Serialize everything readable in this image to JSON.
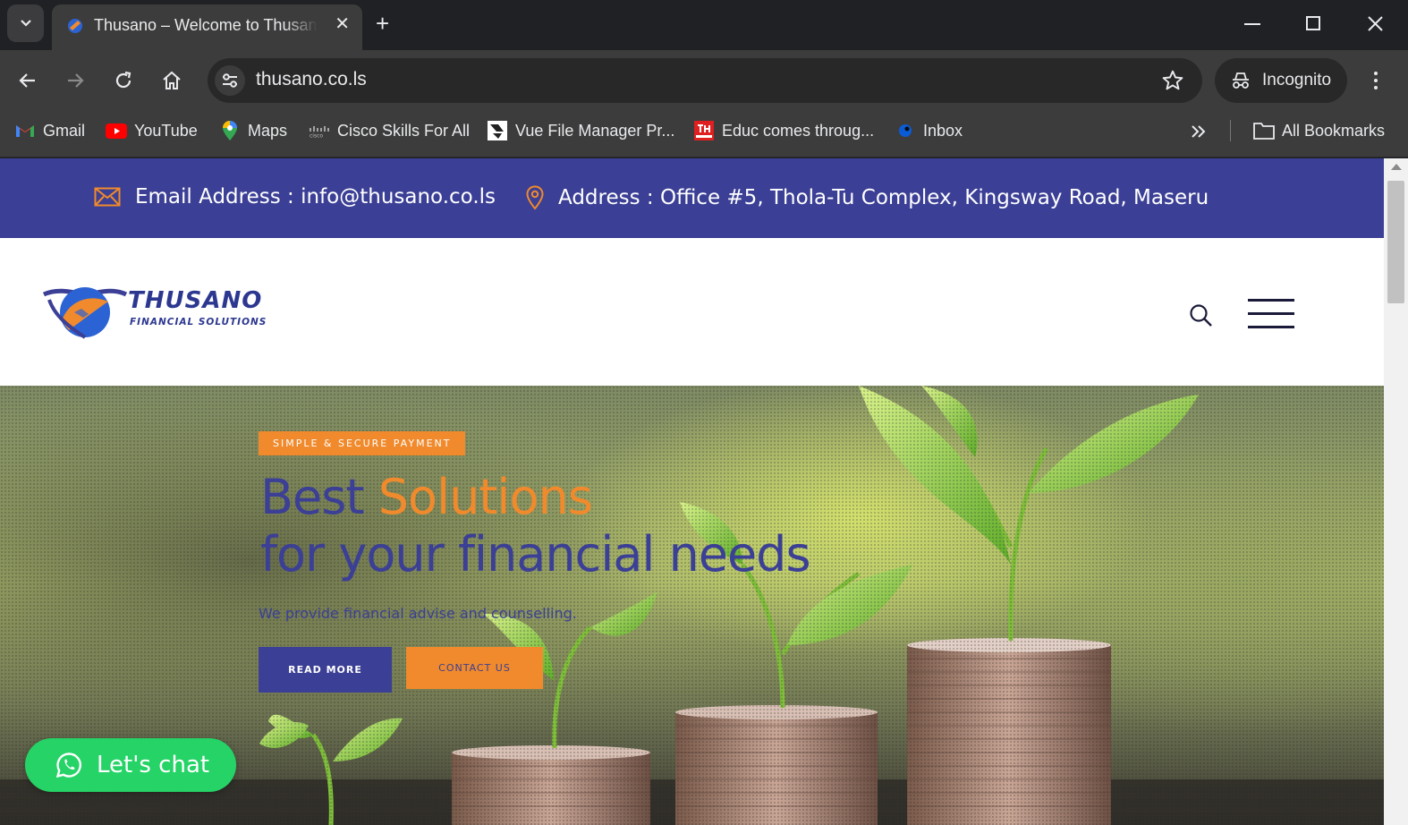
{
  "browser": {
    "tab_title": "Thusano – Welcome to Thusano",
    "url": "thusano.co.ls",
    "incognito_label": "Incognito",
    "bookmarks": [
      {
        "label": "Gmail",
        "icon": "gmail-icon"
      },
      {
        "label": "YouTube",
        "icon": "youtube-icon"
      },
      {
        "label": "Maps",
        "icon": "maps-icon"
      },
      {
        "label": "Cisco Skills For All",
        "icon": "cisco-icon"
      },
      {
        "label": "Vue File Manager Pr...",
        "icon": "vue-file-manager-icon"
      },
      {
        "label": "Educ comes throug...",
        "icon": "the-reporter-icon"
      },
      {
        "label": "Inbox",
        "icon": "inbox-icon"
      }
    ],
    "all_bookmarks_label": "All Bookmarks"
  },
  "topbar": {
    "email_label": "Email Address : info@thusano.co.ls",
    "address_label": "Address : Office #5, Thola-Tu Complex, Kingsway Road, Maseru"
  },
  "logo": {
    "name": "THUSANO",
    "tagline": "FINANCIAL SOLUTIONS"
  },
  "hero": {
    "badge": "SIMPLE & SECURE PAYMENT",
    "headline_start": "Best",
    "headline_accent": "Solutions",
    "headline_line2": "for your financial needs",
    "subtitle": "We provide financial advise and counselling.",
    "read_more": "READ MORE",
    "contact_us": "CONTACT US"
  },
  "chat": {
    "label": "Let's chat"
  },
  "colors": {
    "brand_blue": "#3b3f95",
    "brand_orange": "#f08a2c",
    "chat_green": "#25d366"
  }
}
